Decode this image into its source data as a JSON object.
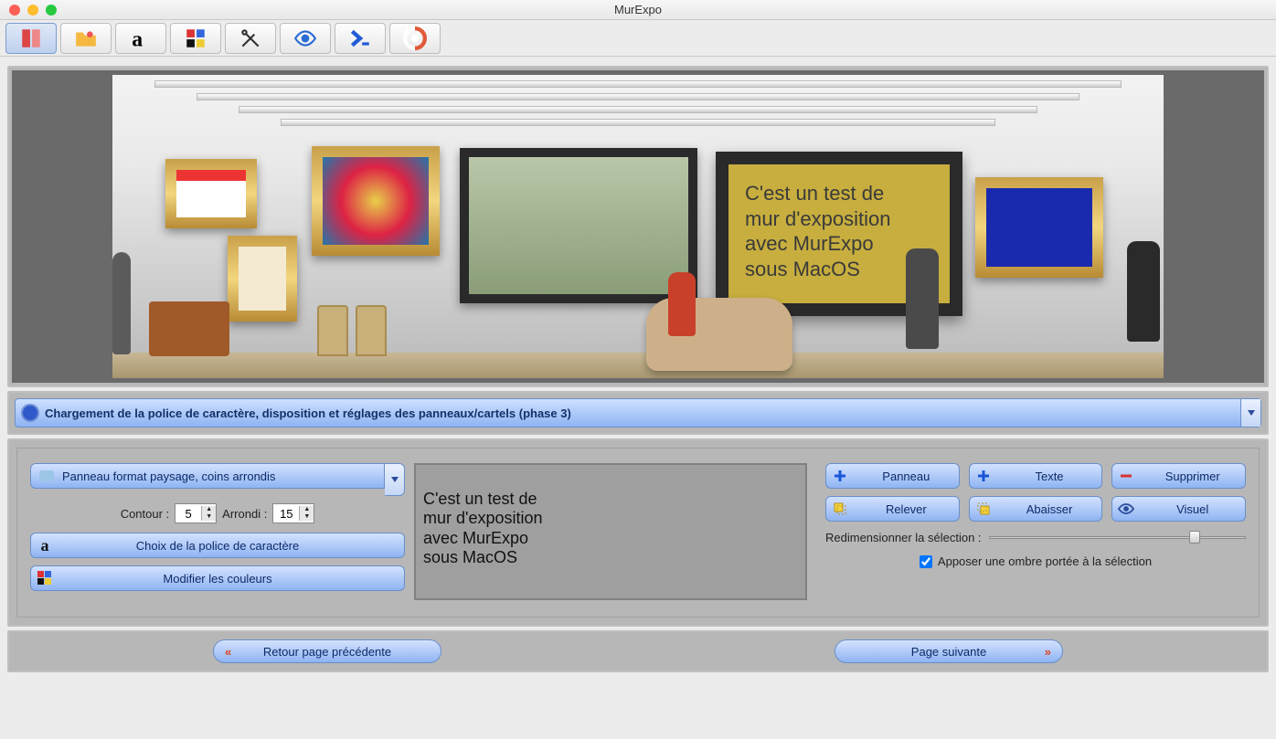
{
  "window": {
    "title": "MurExpo"
  },
  "toolbar": {
    "items": [
      {
        "name": "wall-icon"
      },
      {
        "name": "folder-icon"
      },
      {
        "name": "font-icon"
      },
      {
        "name": "colors-icon"
      },
      {
        "name": "tools-icon"
      },
      {
        "name": "eye-icon"
      },
      {
        "name": "terminal-icon"
      },
      {
        "name": "help-icon"
      }
    ]
  },
  "canvas": {
    "panel_text": "C'est un test de\nmur d'exposition\navec MurExpo\nsous MacOS"
  },
  "phase": {
    "label": "Chargement de la police de caractère, disposition et réglages des panneaux/cartels (phase 3)"
  },
  "panel_settings": {
    "type_label": "Panneau format paysage, coins arrondis",
    "contour_label": "Contour :",
    "contour_value": "5",
    "arrondi_label": "Arrondi :",
    "arrondi_value": "15",
    "font_button": "Choix de la police de caractère",
    "colors_button": "Modifier les couleurs",
    "preview_text": "C'est un test de\nmur d'exposition\navec MurExpo\nsous MacOS"
  },
  "actions": {
    "panneau": "Panneau",
    "texte": "Texte",
    "supprimer": "Supprimer",
    "relever": "Relever",
    "abaisser": "Abaisser",
    "visuel": "Visuel",
    "resize_label": "Redimensionner la sélection :",
    "shadow_label": "Apposer une ombre portée à la sélection",
    "shadow_checked": true,
    "slider_pos_pct": 78
  },
  "nav": {
    "prev": "Retour page précédente",
    "next": "Page suivante"
  }
}
